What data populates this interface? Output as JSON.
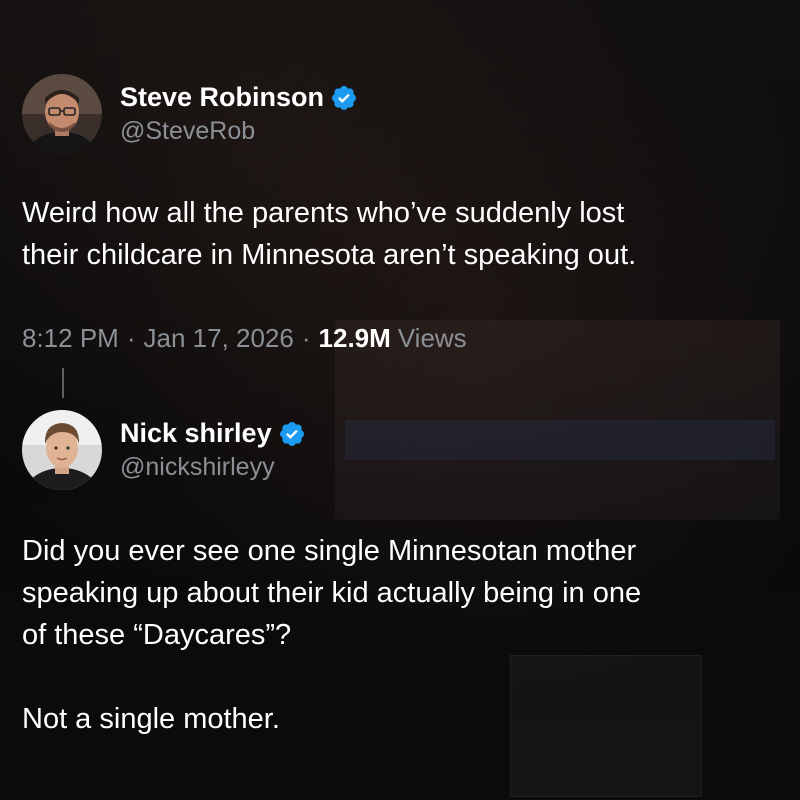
{
  "tweet_main": {
    "display_name": "Steve Robinson",
    "handle": "@SteveRob",
    "text": "Weird how all the parents who’ve suddenly lost\ntheir childcare in Minnesota aren’t speaking out.",
    "time": "8:12 PM",
    "date": "Jan 17, 2026",
    "views_count": "12.9M",
    "views_label": "Views",
    "separator": "·",
    "verified_icon": "verified-badge-icon"
  },
  "tweet_reply": {
    "display_name": "Nick shirley",
    "handle": "@nickshirleyy",
    "text": "Did you ever see one single Minnesotan mother\nspeaking up about their kid actually being in one\nof these “Daycares”?\n\nNot a single mother.",
    "verified_icon": "verified-badge-icon"
  },
  "colors": {
    "background": "#0b0b0c",
    "text_primary": "#ffffff",
    "text_secondary": "#8b9096",
    "verified_blue": "#1d9bf0"
  }
}
